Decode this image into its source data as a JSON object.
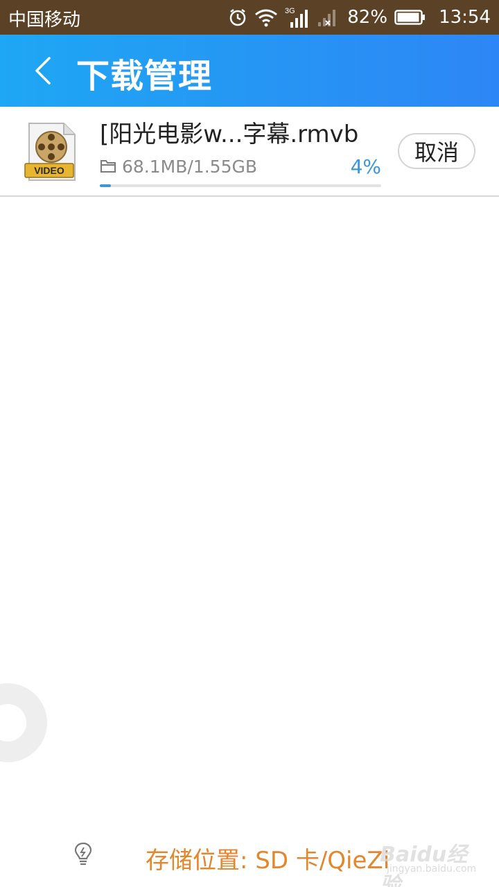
{
  "status_bar": {
    "carrier": "中国移动",
    "network_type": "3G",
    "battery_percent": "82%",
    "time": "13:54"
  },
  "header": {
    "title": "下载管理",
    "back_icon": "chevron-left-icon"
  },
  "download": {
    "file_name": "[阳光电影w...字幕.rmvb",
    "file_icon": "video-file-icon",
    "icon_label": "VIDEO",
    "size_progress": "68.1MB/1.55GB",
    "percent_label": "4%",
    "progress": 0.04,
    "cancel_label": "取消"
  },
  "footer": {
    "storage_text": "存储位置: SD 卡/QieZi",
    "tip_icon": "lightbulb-icon"
  },
  "watermark": {
    "brand": "Baidu经验",
    "url": "jingyan.baidu.com"
  },
  "colors": {
    "header_gradient_start": "#1ea7f4",
    "header_gradient_end": "#2d86f5",
    "status_bar": "#5b4227",
    "accent_blue": "#3a98d8",
    "storage_orange": "#e3862c"
  }
}
